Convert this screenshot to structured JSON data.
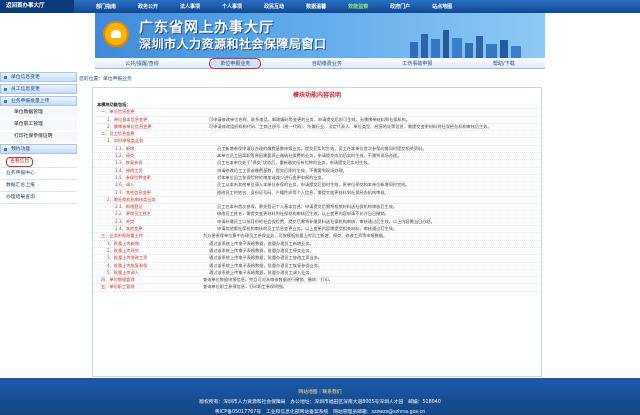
{
  "topnav": {
    "home": "返回首办事大厅",
    "items": [
      {
        "label": "部门指南",
        "green": false
      },
      {
        "label": "政务公开",
        "green": false
      },
      {
        "label": "法人事项",
        "green": false
      },
      {
        "label": "个人事项",
        "green": false
      },
      {
        "label": "政民互动",
        "green": false
      },
      {
        "label": "数据温馨",
        "green": false
      },
      {
        "label": "效能监察",
        "green": true
      },
      {
        "label": "政府门户",
        "green": false
      },
      {
        "label": "站点地图",
        "green": false
      }
    ]
  },
  "banner": {
    "line1": "广东省网上办事大厅",
    "line2": "深圳市人力资源和社会保障局窗口"
  },
  "subnav": [
    {
      "label": "公共/提醒/查询",
      "active": false
    },
    {
      "label": "单位申报业务",
      "active": true
    },
    {
      "label": "自助缴费业务",
      "active": false
    },
    {
      "label": "工伤事故申报",
      "active": false
    },
    {
      "label": "帮助/下载",
      "active": false
    }
  ],
  "sidebar": {
    "menu": [
      {
        "label": "单位信息变更"
      },
      {
        "label": "员工信息变更"
      },
      {
        "label": "业务申报批量上传"
      }
    ],
    "subs": [
      "单位数据管理",
      "单位职工管理",
      "打印社保参保证明"
    ],
    "menu2": [
      {
        "label": "预约功能"
      }
    ],
    "plain": [
      {
        "label": "查看信息",
        "sel": true
      },
      {
        "label": "业务申报中心",
        "sel": false
      },
      {
        "label": "数据汇总上报",
        "sel": false
      },
      {
        "label": "办理结果查询",
        "sel": false
      }
    ]
  },
  "breadcrumb": "您的位置：单位申报业务",
  "content": {
    "title": "模块功能内容说明",
    "rows": [
      {
        "level": "l1",
        "label": "本模块功能包括：",
        "desc": ""
      },
      {
        "level": "l2",
        "label": "一、单位信息变更",
        "desc": ""
      },
      {
        "level": "l3",
        "label": "1、单位基本信息变更",
        "desc": "可申请修改单位名称、联系电话、邮政编码等变更的业务，申请提交后即可生效，无需携带材料到社保机构。"
      },
      {
        "level": "l3",
        "label": "2、需审核单位信息变更",
        "desc": "可申请修改组织机构代码、工商注册号（统一代码）、所属行业、法定代表人、单位类型、经营地址等信息，需提交变更材料到社保经办机构审核后生效。"
      },
      {
        "level": "l2",
        "label": "二、员工信息变更",
        "desc": ""
      },
      {
        "level": "l3",
        "label": "1、实时申报类业务",
        "desc": ""
      },
      {
        "level": "l4",
        "label": "1.1、新增",
        "desc": "员工新增参保申请及办理的缴费基数申报业务，提交后实时生效，员工在本单位首次参保的需同时提交相关资料。"
      },
      {
        "level": "l4",
        "label": "1.2、停交",
        "desc": "本单位员工因离职等原因需要停止缴纳社保费的业务，申请提交成功后实时生效，不需到现场办理。"
      },
      {
        "level": "l4",
        "label": "1.3、恢复参保",
        "desc": "员工在本单位处于\"停交\"状态后，重新缴交所有险种的业务，申请提交后实时生效。"
      },
      {
        "level": "l4",
        "label": "1.4、修改工资",
        "desc": "申请修改员工工资或缴费基数，提交后即时生效，不需要到现场办理。"
      },
      {
        "level": "l4",
        "label": "1.5、参保险种变更",
        "desc": "对本单位员工参保险种的增加或减少进行变更申报的业务。"
      },
      {
        "level": "l4",
        "label": "1.6、调入",
        "desc": "员工从本市其他单位调入本单位参保的业务，申请提交后即时生效，原单位停交和本单位新增同时完成。"
      },
      {
        "level": "l4",
        "label": "1.7、其他信息变更",
        "desc": "修改员工的姓名、身份证号码、户籍性质等个人信息，需提交变更材料到社保经办机构审核。"
      },
      {
        "level": "l3",
        "label": "2、需社保机构审核类业务",
        "desc": ""
      },
      {
        "level": "l4",
        "label": "2.1、新增登记",
        "desc": "员工在本市首次参保，需先登记个人基本信息，申请提交后需将相关材料送社保机构审核后生效。"
      },
      {
        "level": "l4",
        "label": "2.2、更改员工姓名",
        "desc": "修改员工姓名，需提交变更材料到社保机构审核后生效，以上变更内容申请不允许当日撤销。"
      },
      {
        "level": "l4",
        "label": "2.3、补交",
        "desc": "申请补缴员工以前月份的社会保险费，提交后需将补缴资料送社保机构审核，审核通过后生效，以上内容需当日办结。"
      },
      {
        "level": "l4",
        "label": "2.4、其他变更",
        "desc": "申请其他需社保机构审核的员工信息变更业务，以上变更内容需提交相关材料，审核通过后生效。"
      },
      {
        "level": "l2",
        "label": "三、业务申报批量上传",
        "desc": "为方便参保单位集中办理员工参保业务，可按模板批量上传员工新增、停交、修改工资等申报数据。"
      },
      {
        "level": "l3",
        "label": "1、批量上传新增",
        "desc": "通过该系统上传电子表格数据，批量办理员工新增业务。"
      },
      {
        "level": "l3",
        "label": "2、批量上传停交",
        "desc": "通过该系统上传电子表格数据，批量办理员工停交业务。"
      },
      {
        "level": "l3",
        "label": "3、批量上传修改工资",
        "desc": "通过该系统上传电子表格数据，批量办理员工修改工资业务。"
      },
      {
        "level": "l3",
        "label": "4、批量上传恢复参保",
        "desc": "通过该系统上传电子表格数据，批量办理员工恢复参保业务。"
      },
      {
        "level": "l3",
        "label": "5、批量上传调入",
        "desc": "通过该系统上传电子表格数据，批量办理员工调入业务。"
      },
      {
        "level": "l2",
        "label": "四、单位数据管理",
        "desc": "查询单位数据申报信息，并且可对未审核数据进行撤销、删除、打印。"
      },
      {
        "level": "l2",
        "label": "五、单位职工管理",
        "desc": "查询单位职工参保信息，打印职工参保明细。"
      }
    ]
  },
  "footer": {
    "line1": "网站地图｜联系我们",
    "line2": "版权所有：深圳市人力资源和社会保障局　办公地址：深圳市福田区深南大道8005号深圳人才园　邮编：518040",
    "line3": "粤ICP备05017767号　工业和信息化部网站备案系统　网站管理员邮箱：szzwzx@szhrss.gov.cn"
  }
}
